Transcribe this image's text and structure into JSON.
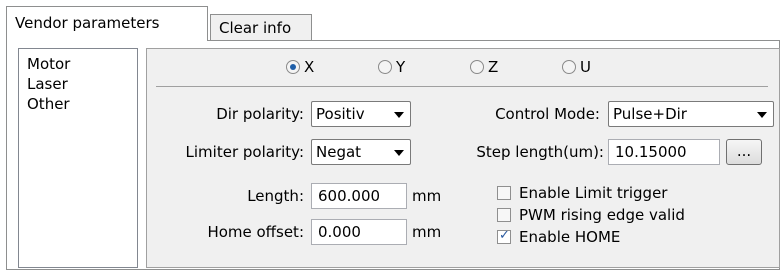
{
  "tabs": [
    {
      "label": "Vendor parameters",
      "active": true
    },
    {
      "label": "Clear info",
      "active": false
    }
  ],
  "sidebar": {
    "items": [
      {
        "label": "Motor"
      },
      {
        "label": "Laser"
      },
      {
        "label": "Other"
      }
    ]
  },
  "axes": [
    {
      "label": "X",
      "selected": true
    },
    {
      "label": "Y",
      "selected": false
    },
    {
      "label": "Z",
      "selected": false
    },
    {
      "label": "U",
      "selected": false
    }
  ],
  "form": {
    "dir_polarity": {
      "label": "Dir polarity:",
      "value": "Positiv"
    },
    "limiter_polarity": {
      "label": "Limiter polarity:",
      "value": "Negat"
    },
    "control_mode": {
      "label": "Control Mode:",
      "value": "Pulse+Dir"
    },
    "step_length": {
      "label": "Step length(um):",
      "value": "10.15000",
      "browse_label": "..."
    },
    "length": {
      "label": "Length:",
      "value": "600.000",
      "unit": "mm"
    },
    "home_offset": {
      "label": "Home offset:",
      "value": "0.000",
      "unit": "mm"
    }
  },
  "checkboxes": [
    {
      "label": "Enable Limit trigger",
      "checked": false
    },
    {
      "label": "PWM rising edge valid",
      "checked": false
    },
    {
      "label": "Enable HOME",
      "checked": true
    }
  ]
}
